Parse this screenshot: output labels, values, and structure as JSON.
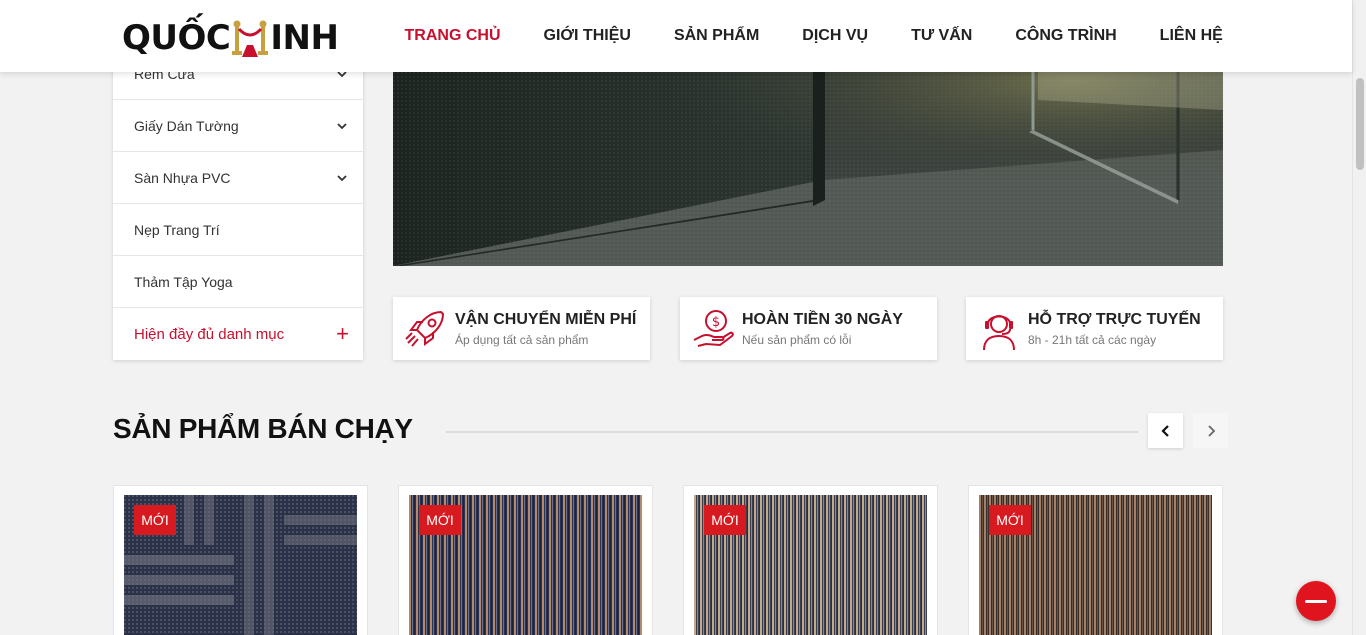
{
  "logo": {
    "text_left": "QUỐC",
    "text_right": "INH"
  },
  "nav": {
    "items": [
      {
        "label": "TRANG CHỦ",
        "active": true
      },
      {
        "label": "GIỚI THIỆU",
        "active": false
      },
      {
        "label": "SẢN PHẨM",
        "active": false
      },
      {
        "label": "DỊCH VỤ",
        "active": false
      },
      {
        "label": "TƯ VẤN",
        "active": false
      },
      {
        "label": "CÔNG TRÌNH",
        "active": false
      },
      {
        "label": "LIÊN HỆ",
        "active": false
      }
    ]
  },
  "sidebar": {
    "items": [
      {
        "label": "Rèm Cửa"
      },
      {
        "label": "Giấy Dán Tường"
      },
      {
        "label": "Sàn Nhựa PVC"
      },
      {
        "label": "Nẹp Trang Trí"
      },
      {
        "label": "Thảm Tập Yoga"
      }
    ],
    "more_label": "Hiện đầy đủ danh mục",
    "more_icon": "+"
  },
  "features": [
    {
      "title": "VẬN CHUYỂN MIỄN PHÍ",
      "subtitle": "Áp dụng tất cả sản phẩm",
      "icon": "rocket-icon"
    },
    {
      "title": "HOÀN TIỀN 30 NGÀY",
      "subtitle": "Nếu sản phẩm có lỗi",
      "icon": "money-hand-icon"
    },
    {
      "title": "HỖ TRỢ TRỰC TUYẾN",
      "subtitle": "8h - 21h tất cả các ngày",
      "icon": "support-agent-icon"
    }
  ],
  "bestseller": {
    "title": "SẢN PHẨM BÁN CHẠY",
    "products": [
      {
        "badge": "MỚI"
      },
      {
        "badge": "MỚI"
      },
      {
        "badge": "MỚI"
      },
      {
        "badge": "MỚI"
      }
    ]
  },
  "colors": {
    "accent": "#c8102e",
    "badge": "#d71920"
  }
}
